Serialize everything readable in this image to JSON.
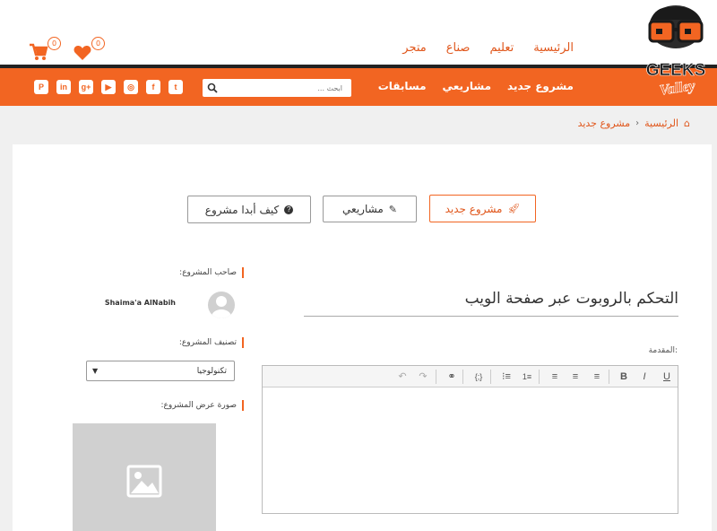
{
  "logo": {
    "line1": "GEEKS",
    "line2": "Valley"
  },
  "top_nav": [
    "الرئيسية",
    "تعليم",
    "صناع",
    "متجر"
  ],
  "cart": {
    "count": "0"
  },
  "favorites": {
    "count": "0"
  },
  "main_nav": [
    "مشروع جديد",
    "مشاريعي",
    "مسابقات"
  ],
  "search": {
    "placeholder": "ابحث ..."
  },
  "social": [
    "twitter-icon",
    "facebook-icon",
    "instagram-icon",
    "youtube-icon",
    "google-plus-icon",
    "linkedin-icon",
    "pinterest-icon"
  ],
  "breadcrumb": {
    "home": "الرئيسية",
    "current": "مشروع جديد"
  },
  "actions": {
    "new_project": "مشروع جديد",
    "my_projects": "مشاريعي",
    "how_to_start": "كيف أبدا مشروع"
  },
  "project": {
    "title": "التحكم بالروبوت عبر صفحة الويب",
    "intro_label": "المقدمة:"
  },
  "sidebar": {
    "owner_label": "صاحب المشروع:",
    "owner_name": "Shaima'a AlNabih",
    "category_label": "تصنيف المشروع:",
    "category_value": "تكنولوجيا",
    "image_label": "صورة عرض المشروع:"
  },
  "colors": {
    "accent": "#f26522",
    "dark": "#222222"
  }
}
